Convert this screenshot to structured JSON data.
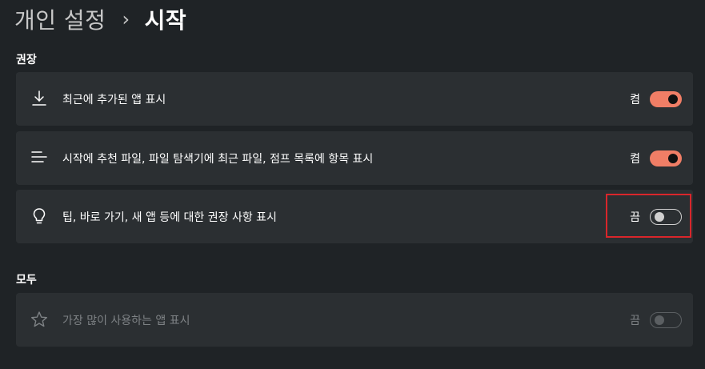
{
  "breadcrumb": {
    "parent": "개인 설정",
    "separator": "›",
    "current": "시작"
  },
  "sections": {
    "recommended": {
      "label": "권장",
      "items": [
        {
          "icon": "download-icon",
          "label": "최근에 추가된 앱 표시",
          "state": "켬",
          "on": true
        },
        {
          "icon": "list-lines-icon",
          "label": "시작에 추천 파일, 파일 탐색기에 최근 파일, 점프 목록에 항목 표시",
          "state": "켬",
          "on": true
        },
        {
          "icon": "lightbulb-icon",
          "label": "팁, 바로 가기, 새 앱 등에 대한 권장 사항 표시",
          "state": "끔",
          "on": false
        }
      ]
    },
    "all": {
      "label": "모두",
      "items": [
        {
          "icon": "star-icon",
          "label": "가장 많이 사용하는 앱 표시",
          "state": "끔",
          "on": false,
          "disabled": true
        }
      ]
    }
  },
  "colors": {
    "background": "#1f2326",
    "card": "#2b2f32",
    "toggle_on": "#f07e66",
    "highlight": "#d9262b"
  }
}
